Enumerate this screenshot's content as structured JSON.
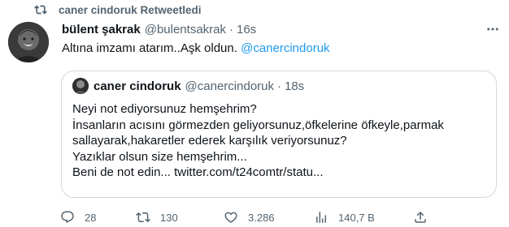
{
  "retweet_bar": {
    "text": "caner cindoruk Retweetledi"
  },
  "tweet": {
    "author_name": "bülent şakrak",
    "handle": "@bulentsakrak",
    "separator": "·",
    "time": "16s",
    "text": "Altına imzamı atarım..Aşk oldun.",
    "mention": "@canercindoruk"
  },
  "quote": {
    "author_name": "caner cindoruk",
    "handle": "@canercindoruk",
    "separator": "·",
    "time": "18s",
    "lines": [
      "Neyi not ediyorsunuz hemşehrim?",
      "İnsanların acısını görmezden geliyorsunuz,öfkelerine öfkeyle,parmak",
      "sallayarak,hakaretler ederek karşılık veriyorsunuz?",
      "Yazıklar olsun size hemşehrim...",
      "Beni de not edin... twitter.com/t24comtr/statu..."
    ]
  },
  "actions": {
    "replies": "28",
    "retweets": "130",
    "likes": "3.286",
    "views": "140,7 B"
  },
  "icons": {
    "retweet_bar": "retweet-icon",
    "more": "more-icon",
    "reply": "reply-icon",
    "retweet": "retweet-icon",
    "like": "heart-icon",
    "views": "views-icon",
    "share": "share-icon"
  },
  "colors": {
    "text": "#0f1419",
    "secondary": "#536471",
    "link": "#1d9bf0",
    "border": "#cfd9de"
  }
}
